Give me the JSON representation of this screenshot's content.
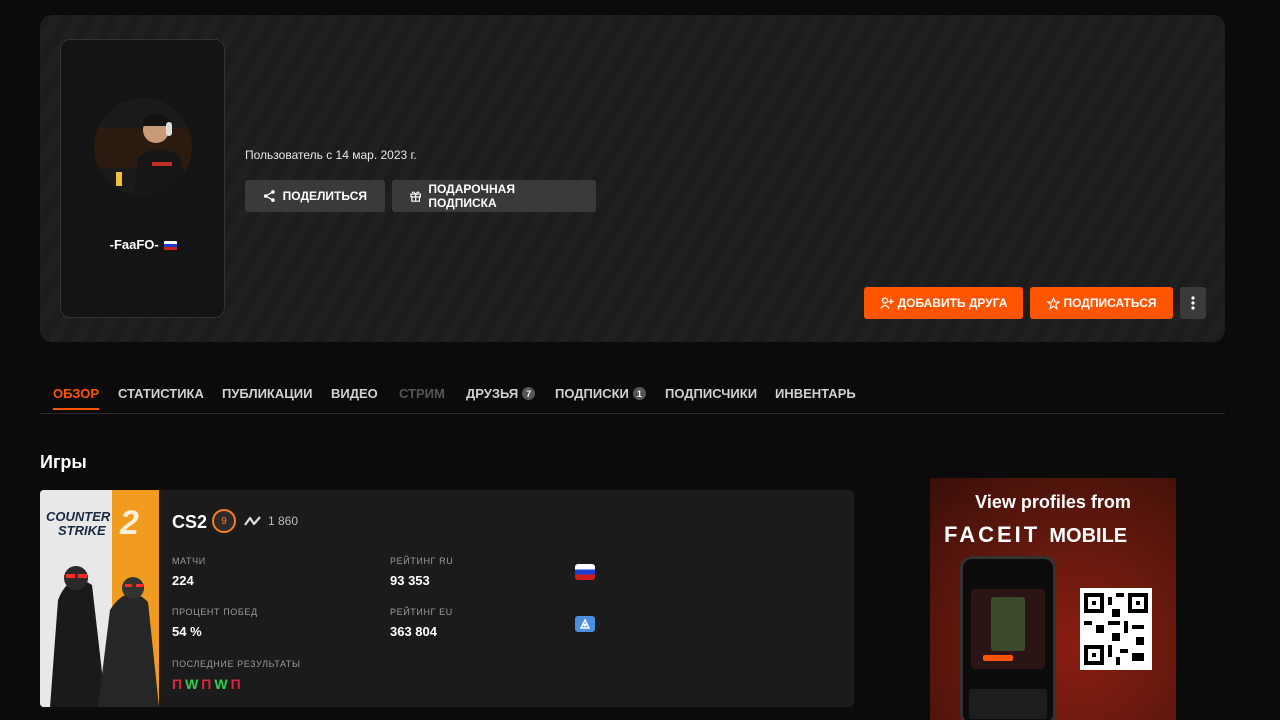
{
  "profile": {
    "nickname": "-FaaFO-",
    "member_since": "Пользователь с 14 мар. 2023 г.",
    "country_flag": "ru"
  },
  "actions": {
    "share_label": "ПОДЕЛИТЬСЯ",
    "gift_label": "ПОДАРОЧНАЯ ПОДПИСКА",
    "add_friend_label": "ДОБАВИТЬ ДРУГА",
    "follow_label": "ПОДПИСАТЬСЯ"
  },
  "tabs": [
    {
      "label": "ОБЗОР",
      "active": true
    },
    {
      "label": "СТАТИСТИКА"
    },
    {
      "label": "ПУБЛИКАЦИИ"
    },
    {
      "label": "ВИДЕО"
    },
    {
      "label": "СТРИМ",
      "disabled": true
    },
    {
      "label": "ДРУЗЬЯ",
      "count": "7"
    },
    {
      "label": "ПОДПИСКИ",
      "count": "1"
    },
    {
      "label": "ПОДПИСЧИКИ"
    },
    {
      "label": "ИНВЕНТАРЬ"
    }
  ],
  "games_title": "Игры",
  "game": {
    "cover_text_1": "COUNTER",
    "cover_text_2": "STRIKE",
    "cover_num": "2",
    "title": "CS2",
    "level": "9",
    "elo": "1 860",
    "matches_label": "МАТЧИ",
    "matches": "224",
    "winrate_label": "ПРОЦЕНТ ПОБЕД",
    "winrate": "54 %",
    "rating_ru_label": "РЕЙТИНГ RU",
    "rating_ru": "93 353",
    "rating_eu_label": "РЕЙТИНГ EU",
    "rating_eu": "363 804",
    "results_label": "ПОСЛЕДНИЕ РЕЗУЛЬТАТЫ",
    "results": [
      "П",
      "W",
      "П",
      "W",
      "П"
    ]
  },
  "ad": {
    "line1": "View profiles from",
    "brand": "FACEIT",
    "brand_suffix": "MOBILE"
  },
  "colors": {
    "accent": "#ff5500",
    "win": "#2fcf4f",
    "loss": "#e0253c"
  }
}
